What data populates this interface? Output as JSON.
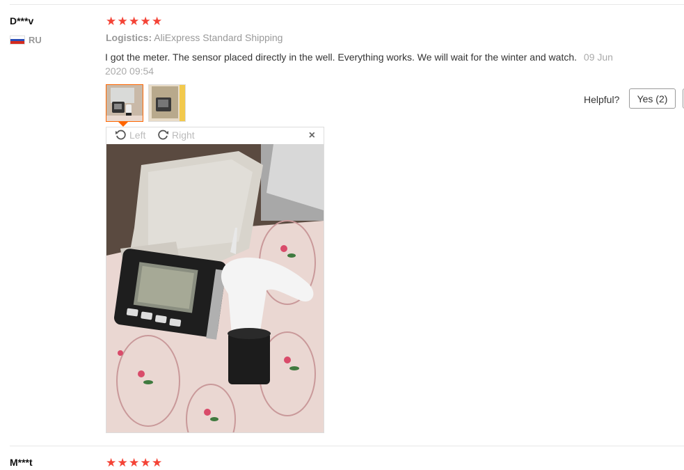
{
  "review": {
    "user": "D***v",
    "country": "RU",
    "stars": [
      "★",
      "★",
      "★",
      "★",
      "★"
    ],
    "logistics_label": "Logistics:",
    "logistics_value": "AliExpress Standard Shipping",
    "text": "I got the meter. The sensor placed directly in the well. Everything works. We will wait for the winter and watch.",
    "date_line1": "09 Jun",
    "date_line2": "2020 09:54",
    "helpful_label": "Helpful?",
    "yes_label": "Yes (2)"
  },
  "viewer": {
    "rotate_left": "Left",
    "rotate_right": "Right",
    "close": "×"
  },
  "next_review": {
    "user": "M***t",
    "stars": [
      "★",
      "★",
      "★",
      "★",
      "★"
    ]
  },
  "colors": {
    "star": "#f44336",
    "active_border": "#ff6600"
  }
}
